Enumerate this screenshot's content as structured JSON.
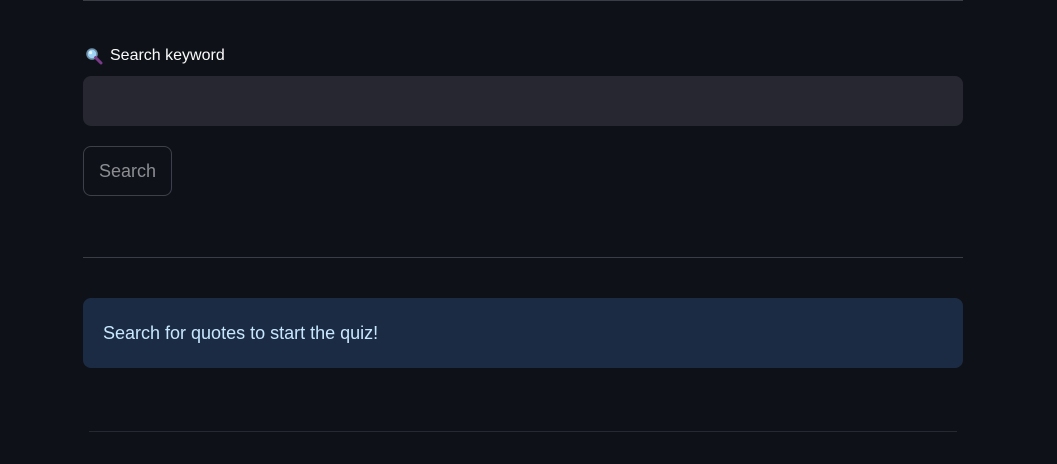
{
  "search": {
    "label": "Search keyword",
    "label_icon": "magnifier-icon",
    "input_value": "",
    "input_placeholder": "",
    "button_label": "Search"
  },
  "info": {
    "message": "Search for quotes to start the quiz!"
  },
  "colors": {
    "background": "#0e1117",
    "input_background": "#262730",
    "info_background": "#1c2b44",
    "info_text": "#c7e7ff",
    "button_text": "#8b8d93"
  }
}
